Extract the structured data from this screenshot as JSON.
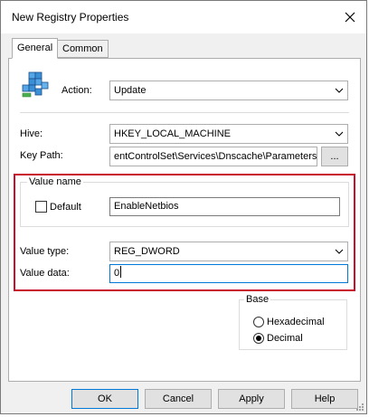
{
  "window": {
    "title": "New Registry Properties"
  },
  "tabs": [
    {
      "label": "General"
    },
    {
      "label": "Common"
    }
  ],
  "general": {
    "action": {
      "label": "Action:",
      "value": "Update"
    },
    "hive": {
      "label": "Hive:",
      "value": "HKEY_LOCAL_MACHINE"
    },
    "key_path": {
      "label": "Key Path:",
      "value": "entControlSet\\Services\\Dnscache\\Parameters",
      "browse_label": "..."
    },
    "value_name": {
      "group_label": "Value name",
      "default_label": "Default",
      "default_checked": false,
      "value": "EnableNetbios"
    },
    "value_type": {
      "label": "Value type:",
      "value": "REG_DWORD"
    },
    "value_data": {
      "label": "Value data:",
      "value": "0"
    },
    "base": {
      "group_label": "Base",
      "options": [
        {
          "label": "Hexadecimal",
          "checked": false
        },
        {
          "label": "Decimal",
          "checked": true
        }
      ]
    }
  },
  "buttons": {
    "ok": "OK",
    "cancel": "Cancel",
    "apply": "Apply",
    "help": "Help"
  },
  "colors": {
    "highlight_box": "#c8102e",
    "focus_border": "#0078d7"
  }
}
